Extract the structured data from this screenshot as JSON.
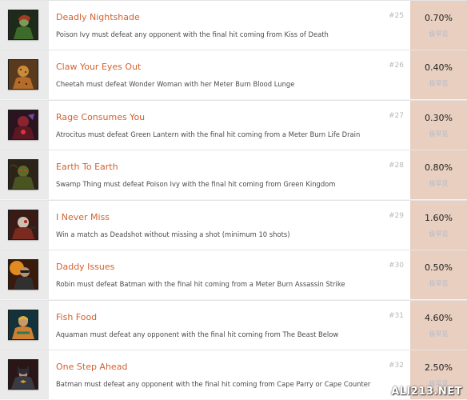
{
  "achievements": [
    {
      "title": "Deadly Nightshade",
      "desc": "Poison Ivy must defeat any opponent with the final hit coming from Kiss of Death",
      "num": "#25",
      "pct": "0.70%",
      "rarity": "极罕见",
      "icon": "poison-ivy-icon"
    },
    {
      "title": "Claw Your Eyes Out",
      "desc": "Cheetah must defeat Wonder Woman with her Meter Burn Blood Lunge",
      "num": "#26",
      "pct": "0.40%",
      "rarity": "极罕见",
      "icon": "cheetah-icon"
    },
    {
      "title": "Rage Consumes You",
      "desc": "Atrocitus must defeat Green Lantern with the final hit coming from a Meter Burn Life Drain",
      "num": "#27",
      "pct": "0.30%",
      "rarity": "极罕见",
      "icon": "atrocitus-icon"
    },
    {
      "title": "Earth To Earth",
      "desc": "Swamp Thing must defeat Poison Ivy with the final hit coming from Green Kingdom",
      "num": "#28",
      "pct": "0.80%",
      "rarity": "极罕见",
      "icon": "swamp-thing-icon"
    },
    {
      "title": "I Never Miss",
      "desc": "Win a match as Deadshot without missing a shot (minimum 10 shots)",
      "num": "#29",
      "pct": "1.60%",
      "rarity": "极罕见",
      "icon": "deadshot-icon"
    },
    {
      "title": "Daddy Issues",
      "desc": "Robin must defeat Batman with the final hit coming from a Meter Burn Assassin Strike",
      "num": "#30",
      "pct": "0.50%",
      "rarity": "极罕见",
      "icon": "robin-icon"
    },
    {
      "title": "Fish Food",
      "desc": "Aquaman must defeat any opponent with the final hit coming from The Beast Below",
      "num": "#31",
      "pct": "4.60%",
      "rarity": "极罕见",
      "icon": "aquaman-icon"
    },
    {
      "title": "One Step Ahead",
      "desc": "Batman must defeat any opponent with the final hit coming from Cape Parry or Cape Counter",
      "num": "#32",
      "pct": "2.50%",
      "rarity": "极罕见",
      "icon": "batman-icon"
    }
  ],
  "watermark": "ALI213.NET",
  "colors": {
    "title": "#d2622f",
    "percent_bg": "#e8cfc0",
    "rarity": "#b5b9c9"
  }
}
